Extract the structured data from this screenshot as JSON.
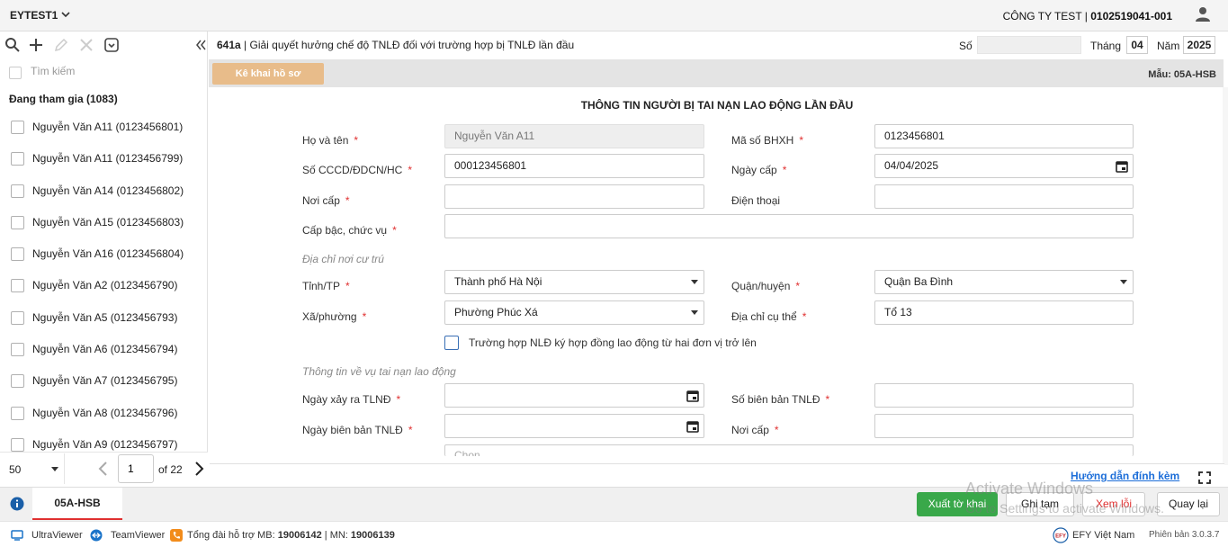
{
  "header": {
    "tenant": "EYTEST1",
    "company_name": "CÔNG TY TEST",
    "company_tax": "0102519041-001"
  },
  "sidebar": {
    "search_placeholder": "Tìm kiếm",
    "group_label": "Đang tham gia (1083)",
    "users": [
      "Nguyễn Văn A11 (0123456801)",
      "Nguyễn Văn A11 (0123456799)",
      "Nguyễn Văn A14 (0123456802)",
      "Nguyễn Văn A15 (0123456803)",
      "Nguyễn Văn A16 (0123456804)",
      "Nguyễn Văn A2 (0123456790)",
      "Nguyễn Văn A5 (0123456793)",
      "Nguyễn Văn A6 (0123456794)",
      "Nguyễn Văn A7 (0123456795)",
      "Nguyễn Văn A8 (0123456796)",
      "Nguyễn Văn A9 (0123456797)"
    ],
    "pager": {
      "page_size": "50",
      "current_page": "1",
      "of_label": "of",
      "total_pages": "22"
    }
  },
  "form_header": {
    "code": "641a",
    "title": "| Giải quyết hưởng chế độ TNLĐ đối với trường hợp bị TNLĐ lần đầu",
    "so_label": "Số",
    "so_value": "",
    "thang_label": "Tháng",
    "thang_value": "04",
    "nam_label": "Năm",
    "nam_value": "2025",
    "tab_label": "Kê khai hồ sơ",
    "mau_label": "Mẫu: 05A-HSB"
  },
  "form": {
    "heading": "THÔNG TIN NGƯỜI BỊ TAI NẠN LAO ĐỘNG LẦN ĐẦU",
    "ho_ten_label": "Họ và tên",
    "ho_ten_value": "Nguyễn Văn A11",
    "ma_so_bhxh_label": "Mã số BHXH",
    "ma_so_bhxh_value": "0123456801",
    "cccd_label": "Số CCCD/ĐDCN/HC",
    "cccd_value": "000123456801",
    "ngay_cap_label": "Ngày cấp",
    "ngay_cap_value": "04/04/2025",
    "noi_cap_label": "Nơi cấp",
    "noi_cap_value": "",
    "dien_thoai_label": "Điện thoại",
    "dien_thoai_value": "",
    "cap_bac_label": "Cấp bậc, chức vụ",
    "cap_bac_value": "",
    "section_address": "Địa chỉ nơi cư trú",
    "tinh_label": "Tỉnh/TP",
    "tinh_value": "Thành phố Hà Nội",
    "quan_label": "Quận/huyện",
    "quan_value": "Quận Ba Đình",
    "xa_label": "Xã/phường",
    "xa_value": "Phường Phúc Xá",
    "dia_chi_label": "Địa chỉ cụ thể",
    "dia_chi_value": "Tổ 13",
    "multi_contract_label": "Trường hợp NLĐ ký hợp đồng lao động từ hai đơn vị trở lên",
    "section_accident": "Thông tin về vụ tai nạn lao động",
    "ngay_xay_ra_label": "Ngày xảy ra TLNĐ",
    "ngay_xay_ra_value": "",
    "so_bien_ban_label": "Số biên bản TNLĐ",
    "so_bien_ban_value": "",
    "ngay_bien_ban_label": "Ngày biên bản TNLĐ",
    "ngay_bien_ban_value": "",
    "noi_cap2_label": "Nơi cấp",
    "noi_cap2_value": "",
    "chon_placeholder": "Chọn"
  },
  "help_link": "Hướng dẫn đính kèm",
  "actions": {
    "form_tab": "05A-HSB",
    "export": "Xuất tờ khai",
    "save": "Ghi tạm",
    "errors": "Xem lỗi",
    "back": "Quay lại"
  },
  "watermark": {
    "line1": "Activate Windows",
    "line2": "Go to Settings to activate Windows."
  },
  "footer": {
    "ultraviewer": "UltraViewer",
    "teamviewer": "TeamViewer",
    "hotline_prefix": "Tổng đài hỗ trợ MB:",
    "hotline_mb": "19006142",
    "hotline_sep": "| MN:",
    "hotline_mn": "19006139",
    "brand": "EFY Việt Nam",
    "version": "Phiên bản 3.0.3.7"
  },
  "colors": {
    "accent_green": "#39a84a",
    "tab_orange": "#e8bc8a",
    "required_red": "#e03030",
    "link_blue": "#1e6fd9"
  }
}
